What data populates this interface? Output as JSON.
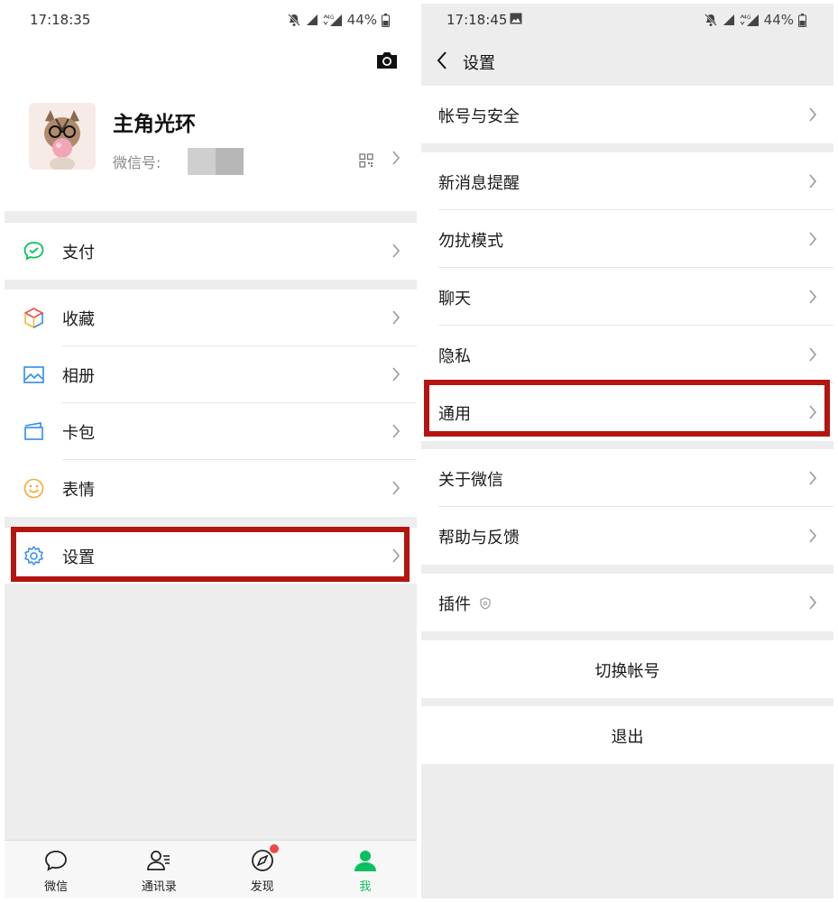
{
  "left": {
    "status": {
      "time": "17:18:35",
      "battery": "44%"
    },
    "profile": {
      "name": "主角光环",
      "id_label": "微信号:"
    },
    "menu": {
      "pay": "支付",
      "favorites": "收藏",
      "album": "相册",
      "cards": "卡包",
      "stickers": "表情",
      "settings": "设置"
    },
    "tabs": [
      {
        "label": "微信",
        "icon": "chat-bubble-icon"
      },
      {
        "label": "通讯录",
        "icon": "contacts-icon"
      },
      {
        "label": "发现",
        "icon": "compass-icon"
      },
      {
        "label": "我",
        "icon": "person-icon"
      }
    ],
    "active_tab": "我"
  },
  "right": {
    "status": {
      "time": "17:18:45",
      "battery": "44%"
    },
    "title": "设置",
    "items": {
      "account_security": "帐号与安全",
      "new_message_alerts": "新消息提醒",
      "do_not_disturb": "勿扰模式",
      "chat": "聊天",
      "privacy": "隐私",
      "general": "通用",
      "about": "关于微信",
      "help_feedback": "帮助与反馈",
      "plugins": "插件"
    },
    "switch_account": "切换帐号",
    "logout": "退出"
  },
  "colors": {
    "highlight": "#b5150f",
    "wechat_green": "#07c160",
    "background_gray": "#ededed",
    "badge_red": "#f04848"
  }
}
